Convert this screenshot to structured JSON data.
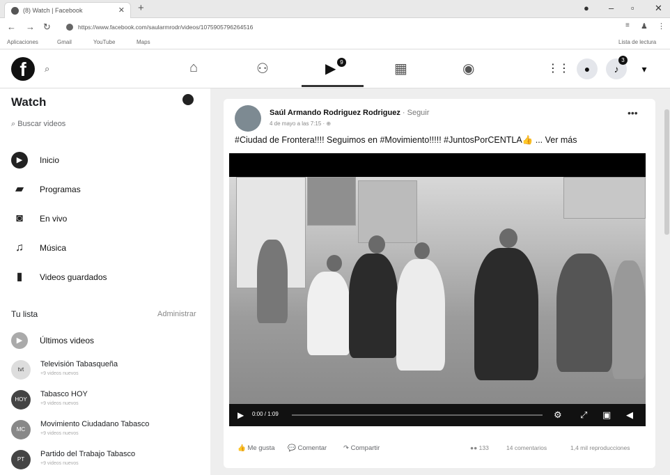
{
  "browser": {
    "tab_title": "(8) Watch | Facebook",
    "url": "https://www.facebook.com/saularmrodr/videos/1075905796264516",
    "bookmarks": [
      "Aplicaciones",
      "Gmail",
      "YouTube",
      "Maps"
    ],
    "reading_list": "Lista de lectura"
  },
  "header": {
    "logo": "f",
    "watch_badge": "9",
    "notif_badge": "3"
  },
  "sidebar": {
    "title": "Watch",
    "search_placeholder": "Buscar videos",
    "items": [
      {
        "label": "Inicio"
      },
      {
        "label": "Programas"
      },
      {
        "label": "En vivo"
      },
      {
        "label": "Música"
      },
      {
        "label": "Videos guardados"
      }
    ],
    "list_title": "Tu lista",
    "manage": "Administrar",
    "latest": "Últimos videos",
    "channels": [
      {
        "name": "Televisión Tabasqueña",
        "sub": "+9 videos nuevos",
        "abbr": "tvt"
      },
      {
        "name": "Tabasco HOY",
        "sub": "+9 videos nuevos",
        "abbr": "HOY"
      },
      {
        "name": "Movimiento Ciudadano Tabasco",
        "sub": "+9 videos nuevos",
        "abbr": "MC"
      },
      {
        "name": "Partido del Trabajo Tabasco",
        "sub": "+9 videos nuevos",
        "abbr": "PT"
      }
    ]
  },
  "post": {
    "author": "Saúl Armando Rodriguez Rodriguez",
    "follow": "· Seguir",
    "date": "4 de mayo a las 7:15 · ⊕",
    "caption": "#Ciudad de Frontera!!!! Seguimos en #Movimiento!!!!! #JuntosPorCENTLA👍 ...",
    "more": "Ver más",
    "video_time": "0:00 / 1:09",
    "like": "Me gusta",
    "comment": "Comentar",
    "share": "Compartir",
    "reactions": "133",
    "comments_count": "14 comentarios",
    "views": "1,4 mil reproducciones"
  }
}
